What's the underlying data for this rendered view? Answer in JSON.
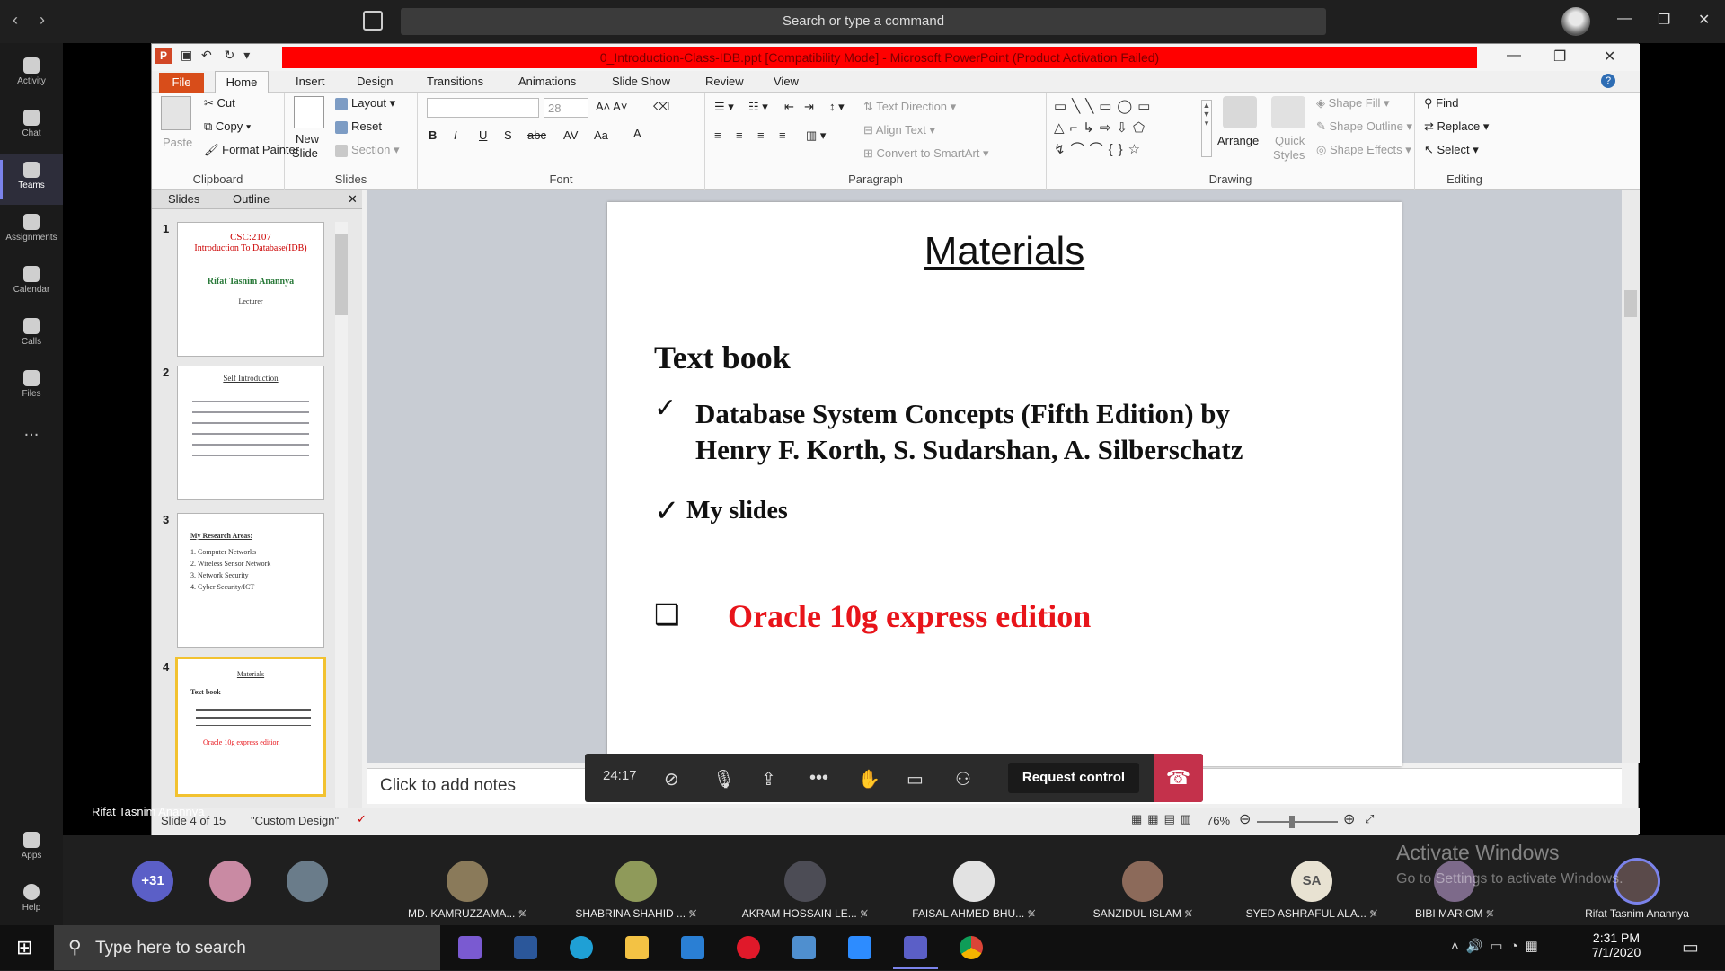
{
  "teams": {
    "search_placeholder": "Search or type a command",
    "rail": [
      {
        "label": "Activity",
        "icon": "bell-icon"
      },
      {
        "label": "Chat",
        "icon": "chat-icon"
      },
      {
        "label": "Teams",
        "icon": "teams-icon",
        "active": true
      },
      {
        "label": "Assignments",
        "icon": "assignments-icon"
      },
      {
        "label": "Calendar",
        "icon": "calendar-icon"
      },
      {
        "label": "Calls",
        "icon": "phone-icon"
      },
      {
        "label": "Files",
        "icon": "files-icon"
      },
      {
        "label": "...",
        "icon": "more-icon"
      }
    ],
    "rail_bottom": [
      {
        "label": "Apps",
        "icon": "apps-icon"
      },
      {
        "label": "Help",
        "icon": "help-icon"
      }
    ],
    "presenter_label": "Rifat Tasnim Anannya"
  },
  "ppt": {
    "title": "0_Introduction-Class-IDB.ppt [Compatibility Mode] - Microsoft PowerPoint (Product Activation Failed)",
    "tabs": [
      "File",
      "Home",
      "Insert",
      "Design",
      "Transitions",
      "Animations",
      "Slide Show",
      "Review",
      "View"
    ],
    "clipboard": {
      "paste": "Paste",
      "cut": "Cut",
      "copy": "Copy",
      "format_painter": "Format Painter",
      "label": "Clipboard"
    },
    "slides_grp": {
      "new_slide_1": "New",
      "new_slide_2": "Slide",
      "layout": "Layout",
      "reset": "Reset",
      "section": "Section",
      "label": "Slides"
    },
    "font": {
      "size": "28",
      "label": "Font"
    },
    "paragraph": {
      "text_direction": "Text Direction",
      "align_text": "Align Text",
      "convert": "Convert to SmartArt",
      "label": "Paragraph"
    },
    "drawing": {
      "arrange": "Arrange",
      "quick_styles_1": "Quick",
      "quick_styles_2": "Styles",
      "shape_fill": "Shape Fill",
      "shape_outline": "Shape Outline",
      "shape_effects": "Shape Effects",
      "label": "Drawing"
    },
    "editing": {
      "find": "Find",
      "replace": "Replace",
      "select": "Select",
      "label": "Editing"
    },
    "panel_tabs": [
      "Slides",
      "Outline"
    ],
    "thumbs": [
      {
        "num": "1",
        "title": "CSC:2107",
        "sub": "Introduction To Database(IDB)",
        "name": "Rifat Tasnim Anannya",
        "role": "Lecturer"
      },
      {
        "num": "2",
        "title": "Self Introduction"
      },
      {
        "num": "3",
        "title": "My Research Areas:",
        "items": [
          "1. Computer Networks",
          "2. Wireless Sensor Network",
          "3. Network Security",
          "4. Cyber Security/ICT"
        ]
      },
      {
        "num": "4",
        "title": "Materials",
        "line1": "Text book",
        "line2": "Oracle 10g express edition"
      }
    ],
    "slide": {
      "title": "Materials",
      "heading": "Text book",
      "bullet1_l1": "Database System Concepts (Fifth Edition) by",
      "bullet1_l2": "Henry F. Korth, S. Sudarshan, A. Silberschatz",
      "bullet2": "My slides",
      "item": "Oracle 10g express edition",
      "check": "✓",
      "box": "❑"
    },
    "notes_placeholder": "Click to add notes",
    "status": {
      "slide": "Slide 4 of 15",
      "theme": "\"Custom Design\"",
      "zoom": "76%"
    }
  },
  "call": {
    "timer": "24:17",
    "request_control": "Request control"
  },
  "participants": [
    {
      "name": "",
      "badge": "+31",
      "color": "#5b5fc7"
    },
    {
      "name": "",
      "color": "#c98aa3"
    },
    {
      "name": "",
      "color": "#6a7c8a"
    },
    {
      "name": "MD. KAMRUZZAMA...",
      "color": "#8a7a5a"
    },
    {
      "name": "SHABRINA SHAHID ...",
      "color": "#8f9a5a"
    },
    {
      "name": "AKRAM HOSSAIN LE...",
      "color": "#4c4c55"
    },
    {
      "name": "FAISAL AHMED BHU...",
      "color": "#e2e2e2"
    },
    {
      "name": "SANZIDUL ISLAM",
      "color": "#8c6a5a"
    },
    {
      "name": "SYED ASHRAFUL ALA...",
      "badge": "SA",
      "color": "#e8e2d2"
    },
    {
      "name": "BIBI MARIOM",
      "color": "#7d6a8a"
    },
    {
      "name": "Rifat Tasnim Anannya",
      "color": "#5a4a4a"
    }
  ],
  "watermark": {
    "line1": "Activate Windows",
    "line2": "Go to Settings to activate Windows."
  },
  "taskbar": {
    "search": "Type here to search",
    "time": "2:31 PM",
    "date": "7/1/2020"
  },
  "colors": {
    "title_red": "#ff0000",
    "oracle_red": "#e8141a",
    "hangup": "#c4314b",
    "teams_accent": "#7b83eb",
    "file_tab": "#d84d1a"
  }
}
